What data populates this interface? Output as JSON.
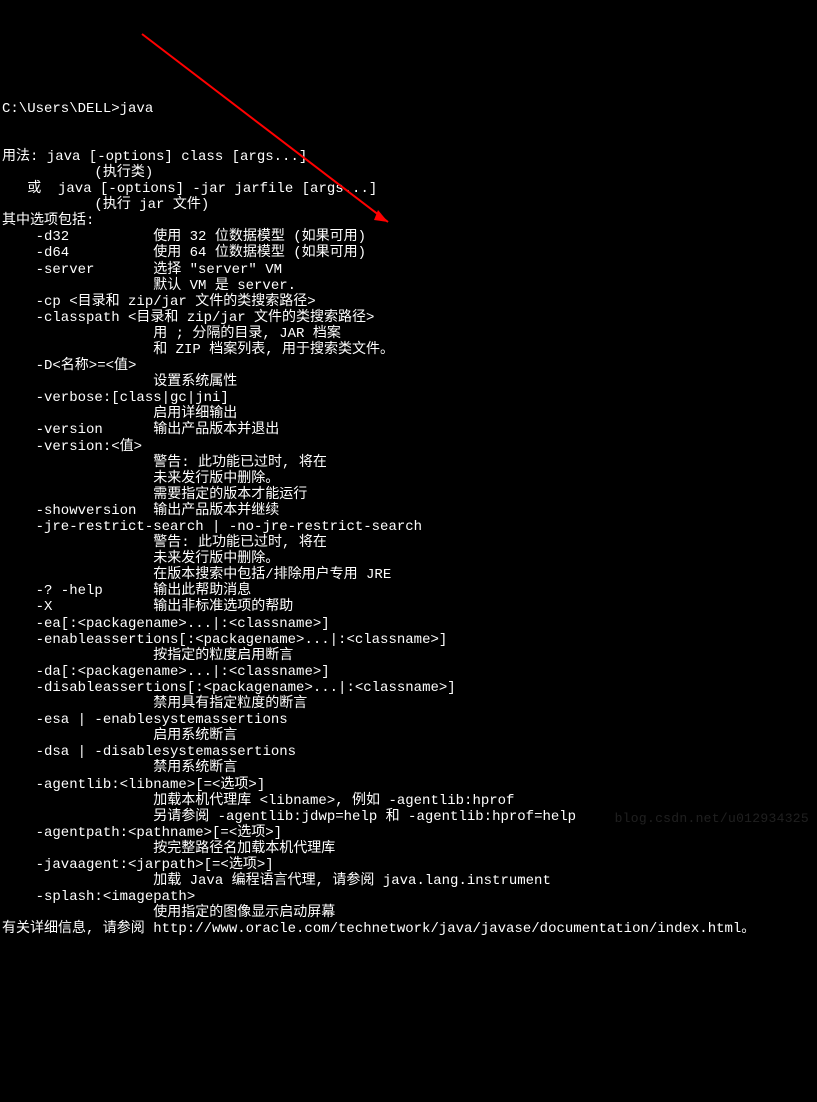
{
  "terminal": {
    "prompt": "C:\\Users\\DELL>java",
    "lines": [
      "用法: java [-options] class [args...]",
      "           (执行类)",
      "   或  java [-options] -jar jarfile [args...]",
      "           (执行 jar 文件)",
      "其中选项包括:",
      "    -d32          使用 32 位数据模型 (如果可用)",
      "    -d64          使用 64 位数据模型 (如果可用)",
      "    -server       选择 \"server\" VM",
      "                  默认 VM 是 server.",
      "",
      "    -cp <目录和 zip/jar 文件的类搜索路径>",
      "    -classpath <目录和 zip/jar 文件的类搜索路径>",
      "                  用 ; 分隔的目录, JAR 档案",
      "                  和 ZIP 档案列表, 用于搜索类文件。",
      "    -D<名称>=<值>",
      "                  设置系统属性",
      "    -verbose:[class|gc|jni]",
      "                  启用详细输出",
      "    -version      输出产品版本并退出",
      "    -version:<值>",
      "                  警告: 此功能已过时, 将在",
      "                  未来发行版中删除。",
      "                  需要指定的版本才能运行",
      "    -showversion  输出产品版本并继续",
      "    -jre-restrict-search | -no-jre-restrict-search",
      "                  警告: 此功能已过时, 将在",
      "                  未来发行版中删除。",
      "                  在版本搜索中包括/排除用户专用 JRE",
      "    -? -help      输出此帮助消息",
      "    -X            输出非标准选项的帮助",
      "    -ea[:<packagename>...|:<classname>]",
      "    -enableassertions[:<packagename>...|:<classname>]",
      "                  按指定的粒度启用断言",
      "    -da[:<packagename>...|:<classname>]",
      "    -disableassertions[:<packagename>...|:<classname>]",
      "                  禁用具有指定粒度的断言",
      "    -esa | -enablesystemassertions",
      "                  启用系统断言",
      "    -dsa | -disablesystemassertions",
      "                  禁用系统断言",
      "    -agentlib:<libname>[=<选项>]",
      "                  加载本机代理库 <libname>, 例如 -agentlib:hprof",
      "                  另请参阅 -agentlib:jdwp=help 和 -agentlib:hprof=help",
      "    -agentpath:<pathname>[=<选项>]",
      "                  按完整路径名加载本机代理库",
      "    -javaagent:<jarpath>[=<选项>]",
      "                  加载 Java 编程语言代理, 请参阅 java.lang.instrument",
      "    -splash:<imagepath>",
      "                  使用指定的图像显示启动屏幕",
      "有关详细信息, 请参阅 http://www.oracle.com/technetwork/java/javase/documentation/index.html。"
    ]
  },
  "watermark": "blog.csdn.net/u012934325",
  "annotation": {
    "type": "arrow",
    "color": "#ff0000"
  }
}
